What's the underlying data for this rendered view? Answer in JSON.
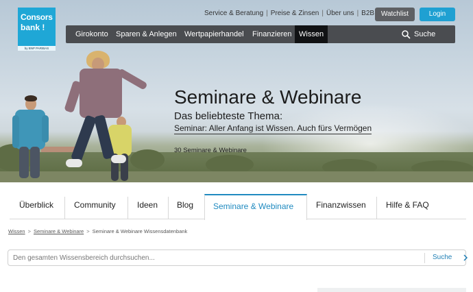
{
  "logo": {
    "line1": "Consors",
    "line2": "bank !",
    "tagline": "by BNP PARIBAS"
  },
  "top_links": [
    "Service & Beratung",
    "Preise & Zinsen",
    "Über uns",
    "B2B"
  ],
  "buttons": {
    "watchlist": "Watchlist",
    "login": "Login"
  },
  "nav": {
    "items": [
      "Girokonto",
      "Sparen & Anlegen",
      "Wertpapierhandel",
      "Finanzieren",
      "Wissen"
    ],
    "active": "Wissen",
    "search_label": "Suche"
  },
  "hero": {
    "title": "Seminare & Webinare",
    "subtitle": "Das beliebteste Thema:",
    "link": "Seminar: Aller Anfang ist Wissen. Auch fürs Vermögen",
    "count": "30 Seminare & Webinare"
  },
  "tabs": {
    "items": [
      "Überblick",
      "Community",
      "Ideen",
      "Blog",
      "Seminare & Webinare",
      "Finanzwissen",
      "Hilfe & FAQ"
    ],
    "active": "Seminare & Webinare"
  },
  "breadcrumb": [
    "Wissen",
    "Seminare & Webinare",
    "Seminare & Webinare Wissensdatenbank"
  ],
  "search": {
    "placeholder": "Den gesamten Wissensbereich durchsuchen...",
    "button": "Suche"
  },
  "colors": {
    "brand": "#1fa7d6",
    "nav_bg": "#4a4c50",
    "active_tab": "#1f8ac0",
    "watchlist_btn": "#5e6064",
    "login_btn": "#1fa0d2"
  }
}
